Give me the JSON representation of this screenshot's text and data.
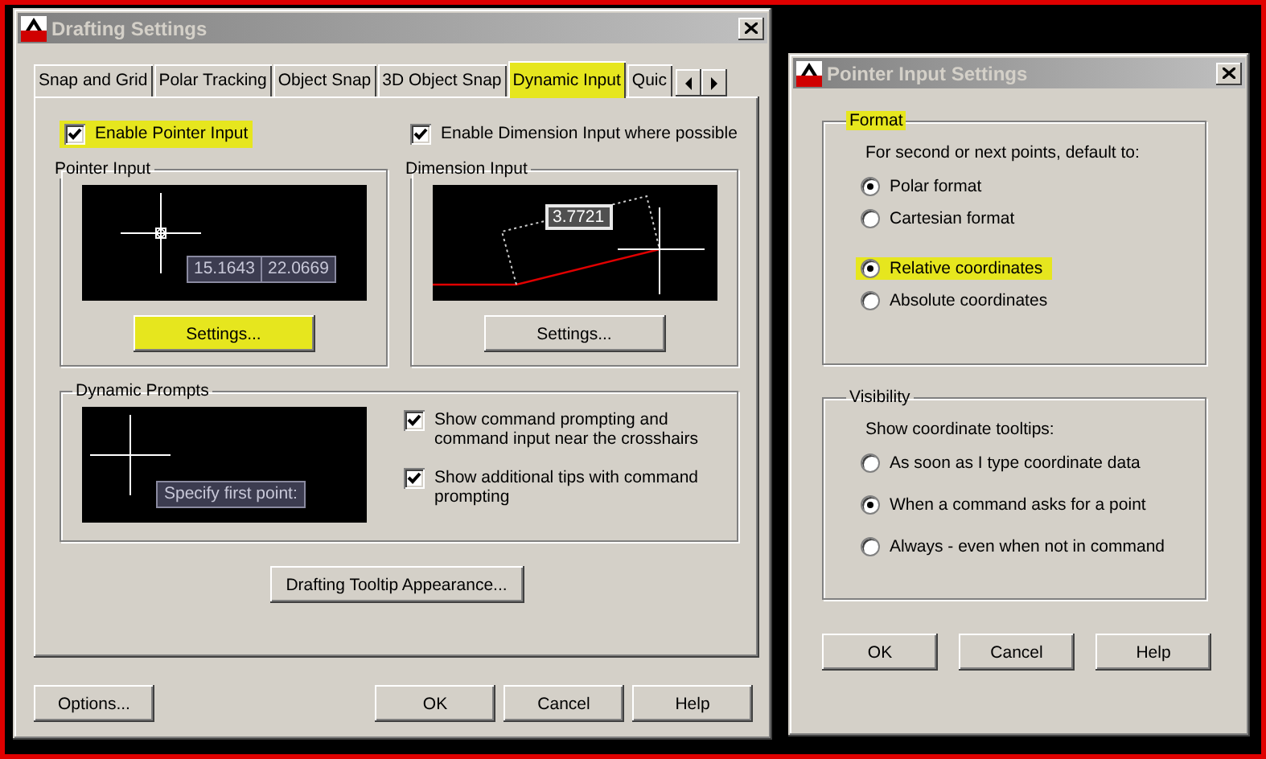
{
  "drafting_settings": {
    "title": "Drafting Settings",
    "tabs": [
      {
        "label": "Snap and Grid",
        "selected": false,
        "highlighted": false
      },
      {
        "label": "Polar Tracking",
        "selected": false,
        "highlighted": false
      },
      {
        "label": "Object Snap",
        "selected": false,
        "highlighted": false
      },
      {
        "label": "3D Object Snap",
        "selected": false,
        "highlighted": false
      },
      {
        "label": "Dynamic Input",
        "selected": true,
        "highlighted": true
      },
      {
        "label": "Quic",
        "selected": false,
        "highlighted": false
      }
    ],
    "options": [
      {
        "label": "Enable Pointer Input",
        "checked": true,
        "highlighted": true
      },
      {
        "label": "Enable Dimension Input where possible",
        "checked": true,
        "highlighted": false
      }
    ],
    "pointer_input": {
      "title": "Pointer Input",
      "tooltips": [
        "15.1643",
        "22.0669"
      ],
      "settings_button": {
        "label": "Settings...",
        "highlighted": true
      }
    },
    "dimension_input": {
      "title": "Dimension Input",
      "tooltip": "3.7721",
      "settings_button": {
        "label": "Settings...",
        "highlighted": false
      }
    },
    "dynamic_prompts": {
      "title": "Dynamic Prompts",
      "tooltip": "Specify first point:",
      "options": [
        {
          "label": "Show command prompting and command input near the crosshairs",
          "checked": true
        },
        {
          "label": "Show additional tips with command prompting",
          "checked": true
        }
      ]
    },
    "appearance_button": "Drafting Tooltip Appearance...",
    "buttons": [
      "Options...",
      "OK",
      "Cancel",
      "Help"
    ]
  },
  "pointer_input_settings": {
    "title": "Pointer Input Settings",
    "format": {
      "title": "Format",
      "highlighted": true,
      "prompt": "For second or next points, default to:",
      "radio_groups": [
        {
          "options": [
            {
              "label": "Polar format",
              "selected": true,
              "highlighted": false
            },
            {
              "label": "Cartesian format",
              "selected": false,
              "highlighted": false
            }
          ]
        },
        {
          "options": [
            {
              "label": "Relative coordinates",
              "selected": true,
              "highlighted": true
            },
            {
              "label": "Absolute coordinates",
              "selected": false,
              "highlighted": false
            }
          ]
        }
      ]
    },
    "visibility": {
      "title": "Visibility",
      "prompt": "Show coordinate tooltips:",
      "options": [
        {
          "label": "As soon as I type coordinate data",
          "selected": false,
          "highlighted": false
        },
        {
          "label": "When a command asks for a point",
          "selected": true,
          "highlighted": false
        },
        {
          "label": "Always - even when not in command",
          "selected": false,
          "highlighted": false
        }
      ]
    },
    "buttons": [
      "OK",
      "Cancel",
      "Help"
    ]
  }
}
